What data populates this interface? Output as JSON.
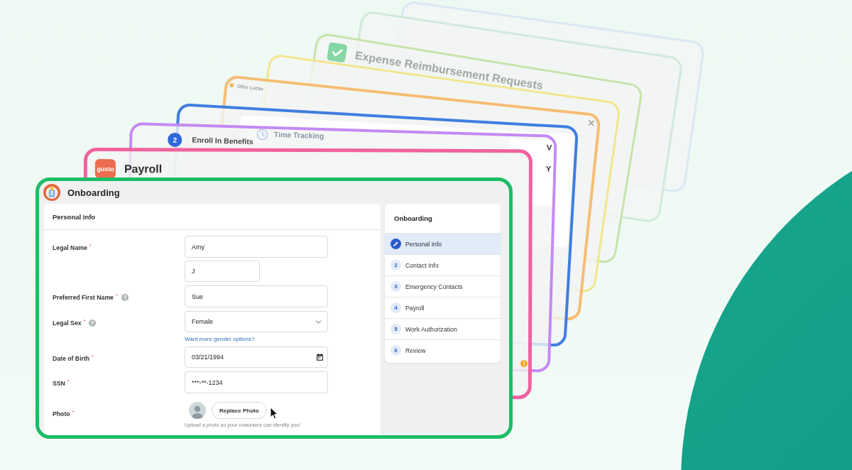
{
  "cards": [
    {
      "kind": "blank"
    },
    {
      "kind": "blank"
    },
    {
      "kind": "expense",
      "title": "Expense Reimbursement Requests"
    },
    {
      "kind": "blank"
    },
    {
      "kind": "dialog",
      "title": "Offer Letter"
    },
    {
      "kind": "panel"
    },
    {
      "kind": "task",
      "step": "2",
      "title": "Enroll In Benefits",
      "next_title": "Time Tracking",
      "side_texts": [
        "V",
        "Y"
      ]
    },
    {
      "kind": "app",
      "logo_text": "gusto",
      "title": "Payroll"
    }
  ],
  "front_card": {
    "title": "Onboarding",
    "form": {
      "heading": "Personal Info",
      "fields": [
        {
          "kind": "text",
          "label": "Legal Name",
          "required_mark": "*",
          "help_icon": false,
          "values": [
            "Amy",
            "J"
          ]
        },
        {
          "kind": "text",
          "label": "Preferred First Name",
          "required_mark": "*",
          "help_icon": true,
          "values": [
            "Sue"
          ]
        },
        {
          "kind": "select",
          "label": "Legal Sex",
          "required_mark": "*",
          "help_icon": true,
          "value": "Female",
          "link": "Want more gender options?"
        },
        {
          "kind": "date",
          "label": "Date of Birth",
          "required_mark": "*",
          "help_icon": false,
          "value": "03/21/1994"
        },
        {
          "kind": "text",
          "label": "SSN",
          "required_mark": "*",
          "help_icon": false,
          "values": [
            "***-**-1234"
          ]
        },
        {
          "kind": "photo",
          "label": "Photo",
          "required_mark": "*",
          "help_icon": false,
          "button": "Replace Photo",
          "hint": "Upload a photo so your coworkers can identify you!"
        }
      ]
    },
    "sidebar": {
      "title": "Onboarding",
      "steps": [
        {
          "kind": "edit",
          "label": "Personal Info",
          "selected": true
        },
        {
          "kind": "number",
          "number": "2",
          "label": "Contact Info",
          "selected": false
        },
        {
          "kind": "number",
          "number": "3",
          "label": "Emergency Contacts",
          "selected": false
        },
        {
          "kind": "number",
          "number": "4",
          "label": "Payroll",
          "selected": false
        },
        {
          "kind": "number",
          "number": "5",
          "label": "Work Authorization",
          "selected": false
        },
        {
          "kind": "number",
          "number": "6",
          "label": "Review",
          "selected": false
        }
      ]
    }
  }
}
